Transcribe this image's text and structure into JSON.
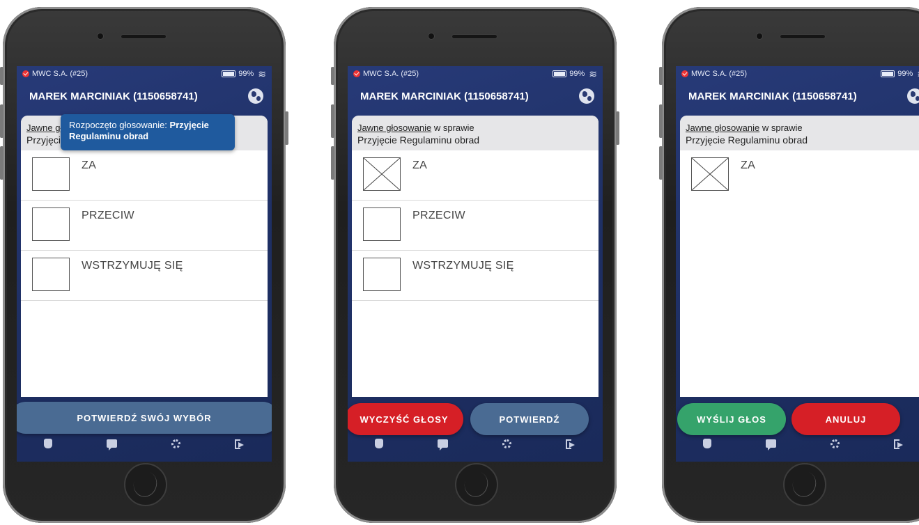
{
  "status": {
    "org": "MWC S.A. (#25)",
    "battery": "99%"
  },
  "user": {
    "name": "MAREK MARCINIAK (1150658741)"
  },
  "vote": {
    "link": "Jawne głosowanie",
    "suffix": " w sprawie",
    "subject": "Przyjęcie Regulaminu obrad"
  },
  "options": [
    "ZA",
    "PRZECIW",
    "WSTRZYMUJĘ SIĘ"
  ],
  "toast": {
    "prefix": "Rozpoczęto głosowanie: ",
    "subject": "Przyjęcie Regulaminu obrad"
  },
  "screens": [
    {
      "buttons": {
        "confirm_choice": "POTWIERDŹ SWÓJ WYBÓR"
      }
    },
    {
      "buttons": {
        "clear": "WYCZYŚĆ GŁOSY",
        "confirm": "POTWIERDŹ"
      }
    },
    {
      "buttons": {
        "send": "WYŚLIJ GŁOS",
        "cancel": "ANULUJ"
      }
    }
  ],
  "colors": {
    "header_bg": "#273a78",
    "clear_red": "#d61f26",
    "confirm_blue": "#4a6b93",
    "send_green": "#35a36b",
    "toast_blue": "#1f5a9e"
  },
  "nav_icons": [
    "hand-icon",
    "chat-icon",
    "gear-icon",
    "logout-icon"
  ]
}
